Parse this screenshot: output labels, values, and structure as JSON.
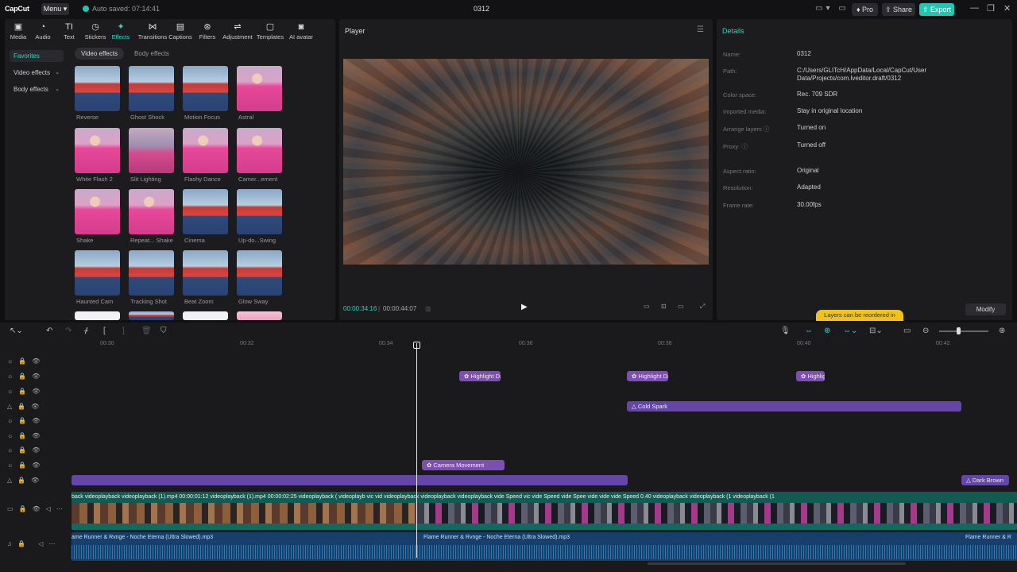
{
  "titlebar": {
    "logo": "CapCut",
    "menu": "Menu",
    "autosave": "Auto saved: 07:14:41",
    "project_title": "0312",
    "pro": "Pro",
    "share": "Share",
    "export": "Export"
  },
  "toolbar": [
    "Media",
    "Audio",
    "Text",
    "Stickers",
    "Effects",
    "Transitions",
    "Captions",
    "Filters",
    "Adjustment",
    "Templates",
    "AI avatar"
  ],
  "sidenav": {
    "favorites": "Favorites",
    "video_effects": "Video effects",
    "body_effects": "Body effects"
  },
  "subtabs": {
    "video": "Video effects",
    "body": "Body effects"
  },
  "effects": [
    "Reverse",
    "Ghost Shock",
    "Motion Focus",
    "Astral",
    "White Flash 2",
    "Slit Lighting",
    "Flashy Dance",
    "Camer...ement",
    "Shake",
    "Repeat... Shake",
    "Cinema",
    "Up-do...Swing",
    "Haunted Cam",
    "Tracking Shot",
    "Beat Zoom",
    "Glow Sway"
  ],
  "player": {
    "title": "Player",
    "current_time": "00:00:34:16",
    "total_time": "00:00:44:07"
  },
  "details": {
    "title": "Details",
    "rows": [
      {
        "label": "Name:",
        "value": "0312"
      },
      {
        "label": "Path:",
        "value": "C:/Users/GLITcH/AppData/Local/CapCut/User Data/Projects/com.lveditor.draft/0312"
      },
      {
        "label": "Color space:",
        "value": "Rec. 709 SDR"
      },
      {
        "label": "Imported media:",
        "value": "Stay in original location"
      },
      {
        "label": "Arrange layers ⓘ",
        "value": "Turned on"
      },
      {
        "label": "Proxy: ⓘ",
        "value": "Turned off"
      },
      {
        "label": "Aspect ratio:",
        "value": "Original"
      },
      {
        "label": "Resolution:",
        "value": "Adapted"
      },
      {
        "label": "Frame rate:",
        "value": "30.00fps"
      }
    ],
    "tooltip": "Layers can be reordered in",
    "modify": "Modify"
  },
  "ruler": [
    "00:30",
    "00:32",
    "00:34",
    "00:36",
    "00:38",
    "00:40",
    "00:42"
  ],
  "clips": {
    "highlight1": "Highlight Da",
    "highlight2": "Highlight Da",
    "highlight3": "Highlig",
    "cold_spark": "Cold Spark",
    "camera": "Camera Movement",
    "dark_brown": "Dark Brown"
  },
  "video_labels": "back   videoplayback   videoplayback (1).mp4   00:00:01:12      videoplayback (1).mp4   00:00:02:25                                                 videoplayback (   videoplayb   vic   vid   videoplayback   videoplayback   videoplayback   vide   Speed   vic   vide   Speed   vide   Spee   vide   vide   vide   Speed 0.40   videoplayback   videoplayback (1   videoplayback (1",
  "audio": {
    "label1": "ame Runner & Rvnge - Noche Eterna (Ultra Slowed).mp3",
    "label2": "Flame Runner & Rvnge - Noche Eterna (Ultra Slowed).mp3",
    "label3": "Flame Runner & R"
  }
}
